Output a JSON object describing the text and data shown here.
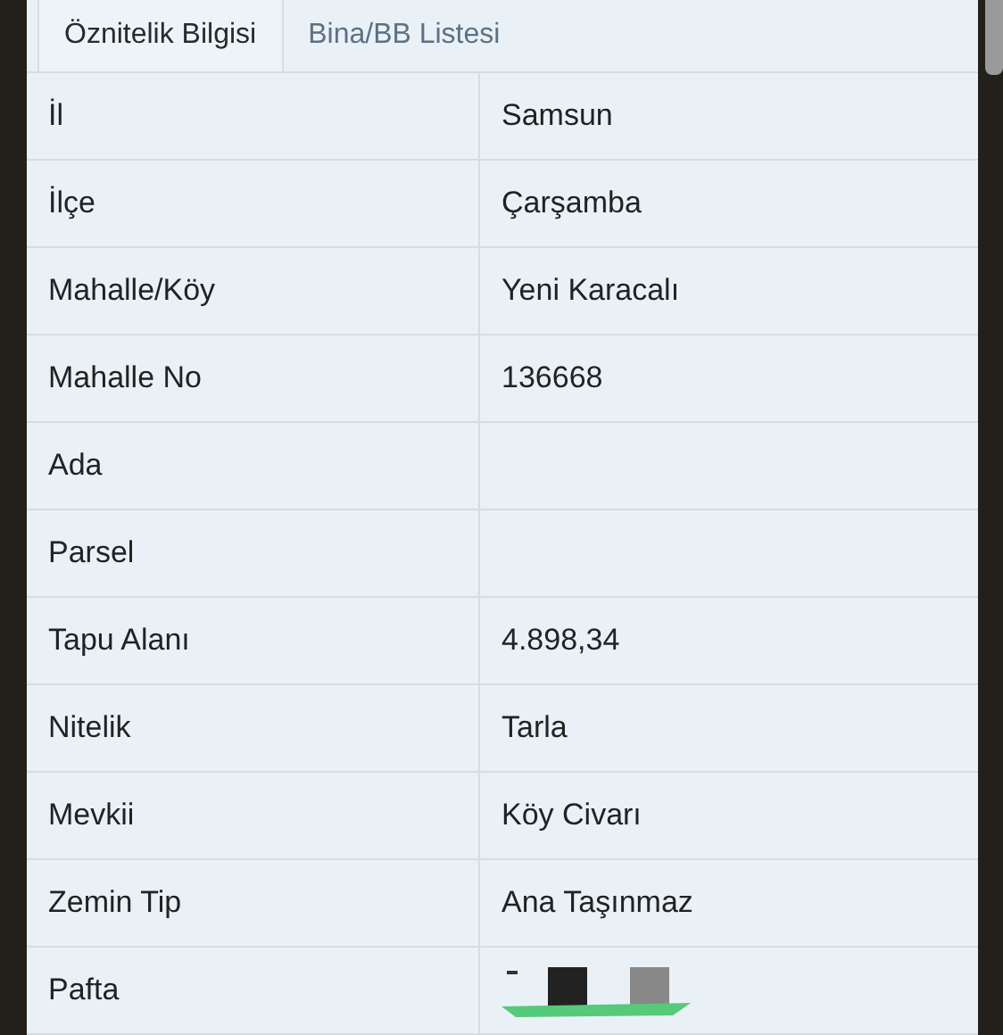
{
  "tabs": [
    {
      "label": "Öznitelik Bilgisi",
      "selected": true
    },
    {
      "label": "Bina/BB Listesi",
      "selected": false
    }
  ],
  "rows": [
    {
      "label": "İl",
      "value": "Samsun"
    },
    {
      "label": "İlçe",
      "value": "Çarşamba"
    },
    {
      "label": "Mahalle/Köy",
      "value": "Yeni Karacalı"
    },
    {
      "label": "Mahalle No",
      "value": "136668"
    },
    {
      "label": "Ada"
    },
    {
      "label": "Parsel"
    },
    {
      "label": "Tapu Alanı",
      "value": "4.898,34"
    },
    {
      "label": "Nitelik",
      "value": "Tarla"
    },
    {
      "label": "Mevkii",
      "value": "Köy Civarı"
    },
    {
      "label": "Zemin Tip",
      "value": "Ana Taşınmaz"
    },
    {
      "label": "Pafta",
      "kind": "icons"
    }
  ]
}
